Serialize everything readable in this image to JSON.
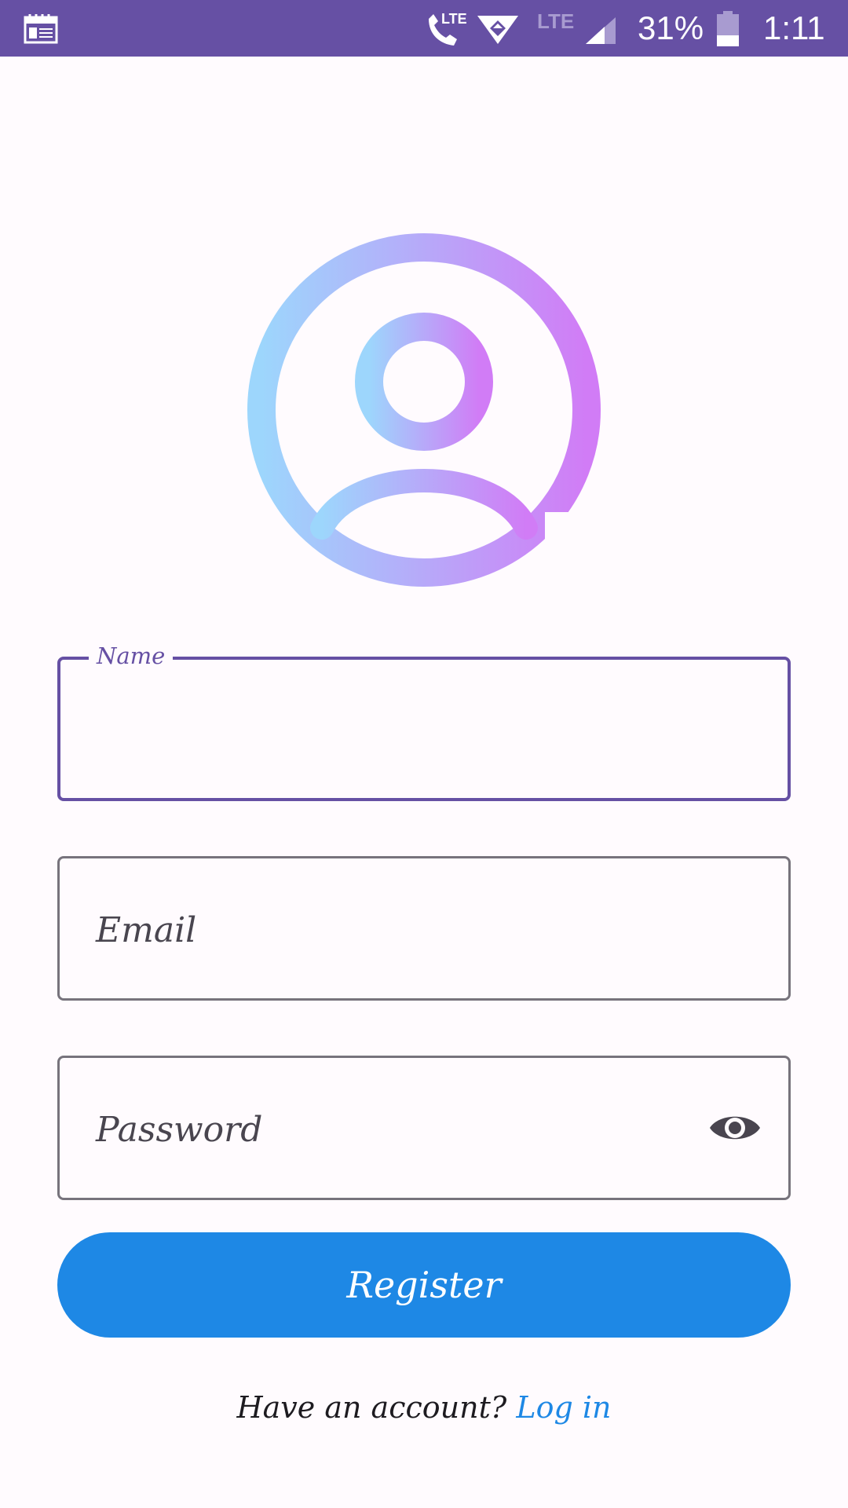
{
  "status_bar": {
    "battery_percent": "31%",
    "time": "1:11",
    "network_label": "LTE",
    "secondary_network_label": "LTE",
    "icons": [
      "calendar-icon",
      "lte-call-icon",
      "wifi-icon",
      "signal-icon",
      "battery-icon"
    ]
  },
  "avatar": {
    "icon": "add-profile-photo-icon",
    "gradient_start": "#9dd6fc",
    "gradient_end": "#d17cf6",
    "plus_color": "#d12fcf"
  },
  "form": {
    "name_label": "Name",
    "email_placeholder": "Email",
    "password_placeholder": "Password",
    "password_toggle_icon": "eye-icon"
  },
  "register_button": "Register",
  "footer": {
    "prompt": "Have an account? ",
    "login_link": "Log in"
  },
  "colors": {
    "status_bar": "#6650a4",
    "focused_border": "#6650a4",
    "primary_button": "#1e88e5",
    "link": "#1e88e5",
    "background": "#fffbfe"
  }
}
